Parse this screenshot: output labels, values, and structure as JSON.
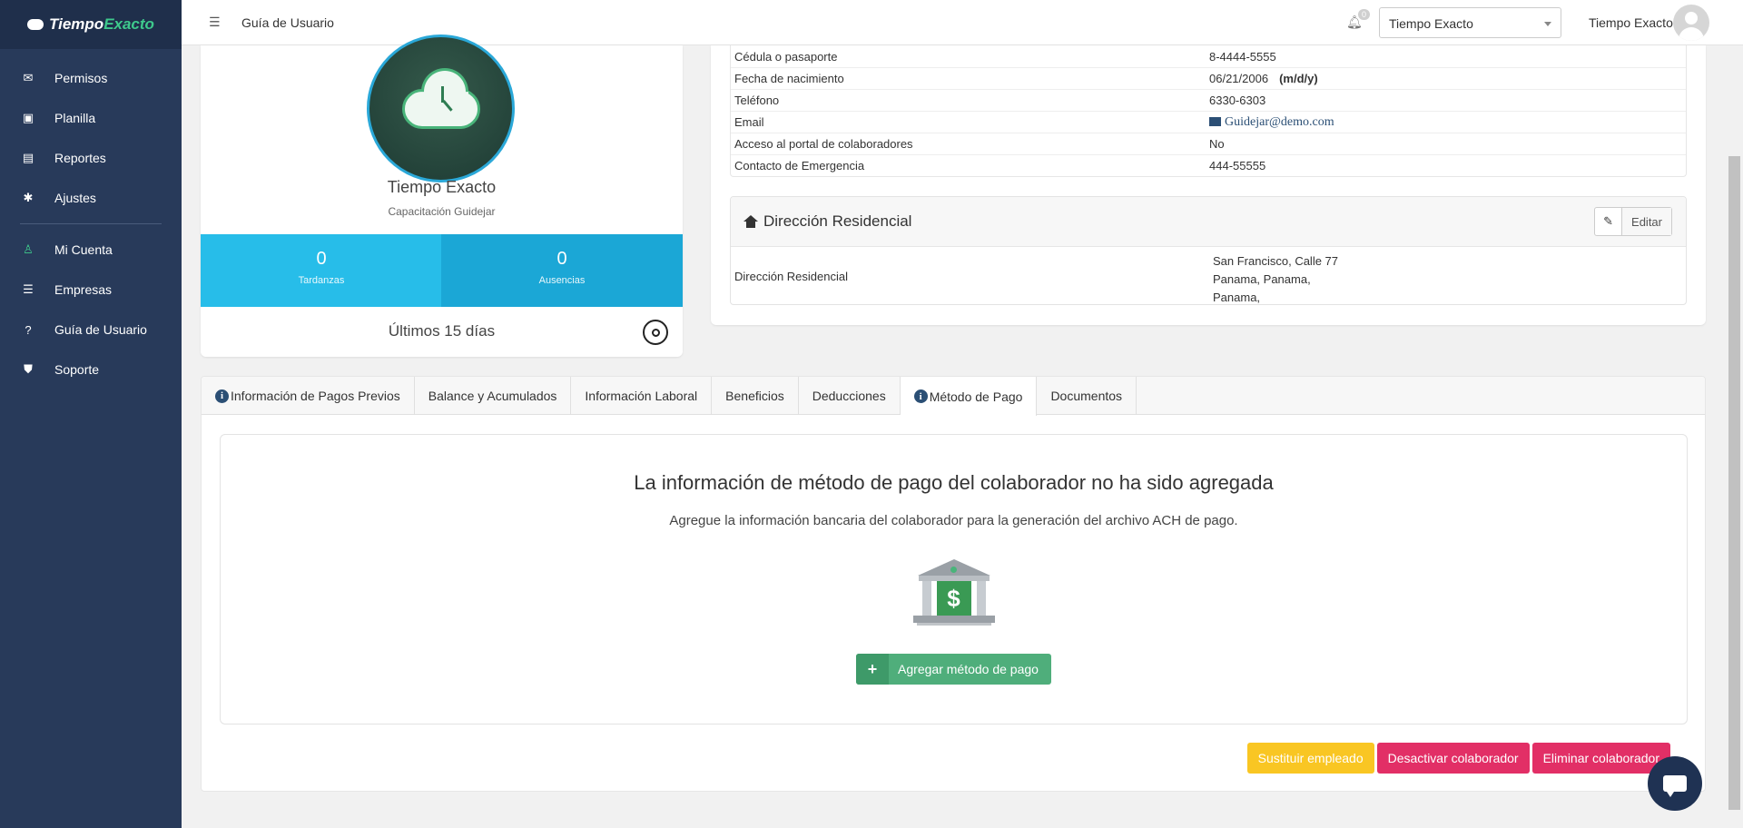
{
  "brand": {
    "part1": "Tiempo",
    "part2": "Exacto"
  },
  "sidebar": {
    "items": [
      {
        "label": "Permisos",
        "icon": "inbox-icon"
      },
      {
        "label": "Planilla",
        "icon": "money-icon"
      },
      {
        "label": "Reportes",
        "icon": "file-icon"
      },
      {
        "label": "Ajustes",
        "icon": "gear-icon"
      },
      {
        "label": "Mi Cuenta",
        "icon": "user-icon"
      },
      {
        "label": "Empresas",
        "icon": "sliders-icon"
      },
      {
        "label": "Guía de Usuario",
        "icon": "question-icon"
      },
      {
        "label": "Soporte",
        "icon": "shield-icon"
      }
    ]
  },
  "topbar": {
    "title": "Guía de Usuario",
    "notifications": "0",
    "company": "Tiempo Exacto",
    "user": "Tiempo Exacto"
  },
  "profile": {
    "name": "Tiempo Exacto",
    "subtitle": "Capacitación Guidejar",
    "stats": [
      {
        "value": "0",
        "label": "Tardanzas"
      },
      {
        "value": "0",
        "label": "Ausencias"
      }
    ],
    "period": "Últimos 15 días"
  },
  "info": {
    "rows": [
      {
        "key": "Cédula o pasaporte",
        "value": "8-4444-5555"
      },
      {
        "key": "Fecha de nacimiento",
        "value": "06/21/2006",
        "extra": "(m/d/y)"
      },
      {
        "key": "Teléfono",
        "value": "6330-6303"
      },
      {
        "key": "Email",
        "value": "Guidejar@demo.com"
      },
      {
        "key": "Acceso al portal de colaboradores",
        "value": "No"
      },
      {
        "key": "Contacto de Emergencia",
        "value": "444-55555"
      }
    ]
  },
  "address": {
    "title": "Dirección Residencial",
    "edit_label": "Editar",
    "key": "Dirección Residencial",
    "lines": [
      "San Francisco, Calle 77",
      "Panama, Panama,",
      "Panama,"
    ]
  },
  "tabs": [
    {
      "label": "Información de Pagos Previos",
      "info": true
    },
    {
      "label": "Balance y Acumulados",
      "info": false
    },
    {
      "label": "Información Laboral",
      "info": false
    },
    {
      "label": "Beneficios",
      "info": false
    },
    {
      "label": "Deducciones",
      "info": false
    },
    {
      "label": "Método de Pago",
      "info": true,
      "active": true
    },
    {
      "label": "Documentos",
      "info": false
    }
  ],
  "payment": {
    "title": "La información de método de pago del colaborador no ha sido agregada",
    "description": "Agregue la información bancaria del colaborador para la generación del archivo ACH de pago.",
    "add_label": "Agregar método de pago",
    "money_symbol": "$"
  },
  "actions": {
    "replace": "Sustituir empleado",
    "deactivate": "Desactivar colaborador",
    "delete": "Eliminar colaborador"
  },
  "colors": {
    "sidebar": "#283a5a",
    "accent_green": "#3ec98c",
    "stat_blue": "#27bde9",
    "danger": "#e22f66",
    "warning": "#f9c623"
  }
}
